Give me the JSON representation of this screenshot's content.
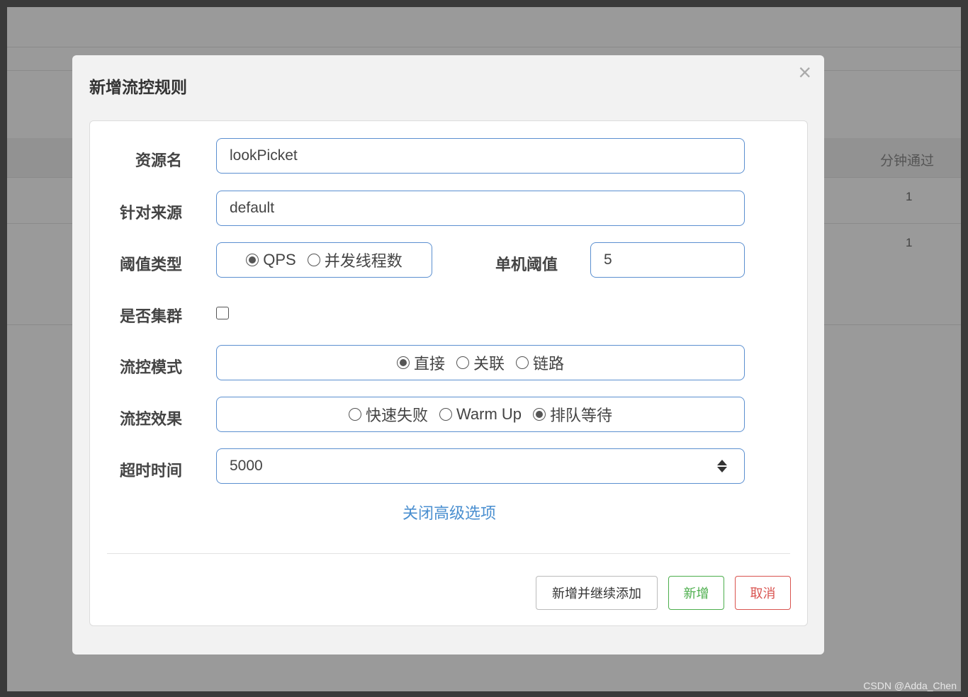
{
  "background": {
    "column_header": "分钟通过",
    "row_values": [
      "1",
      "1"
    ]
  },
  "modal": {
    "title": "新增流控规则",
    "close_symbol": "×",
    "fields": {
      "resource_name": {
        "label": "资源名",
        "value": "lookPicket"
      },
      "limit_app": {
        "label": "针对来源",
        "value": "default"
      },
      "threshold_type": {
        "label": "阈值类型",
        "options": [
          "QPS",
          "并发线程数"
        ],
        "selected": "QPS"
      },
      "single_threshold": {
        "label": "单机阈值",
        "value": "5"
      },
      "cluster": {
        "label": "是否集群",
        "checked": false
      },
      "strategy": {
        "label": "流控模式",
        "options": [
          "直接",
          "关联",
          "链路"
        ],
        "selected": "直接"
      },
      "control_behavior": {
        "label": "流控效果",
        "options": [
          "快速失败",
          "Warm Up",
          "排队等待"
        ],
        "selected": "排队等待"
      },
      "timeout": {
        "label": "超时时间",
        "value": "5000"
      }
    },
    "advanced_link": "关闭高级选项",
    "buttons": {
      "add_continue": "新增并继续添加",
      "add": "新增",
      "cancel": "取消"
    }
  },
  "watermark": "CSDN @Adda_Chen",
  "colors": {
    "accent_border": "#5b8fd0",
    "link": "#4a8fd0",
    "success": "#4cae4c",
    "danger": "#d9534f"
  }
}
